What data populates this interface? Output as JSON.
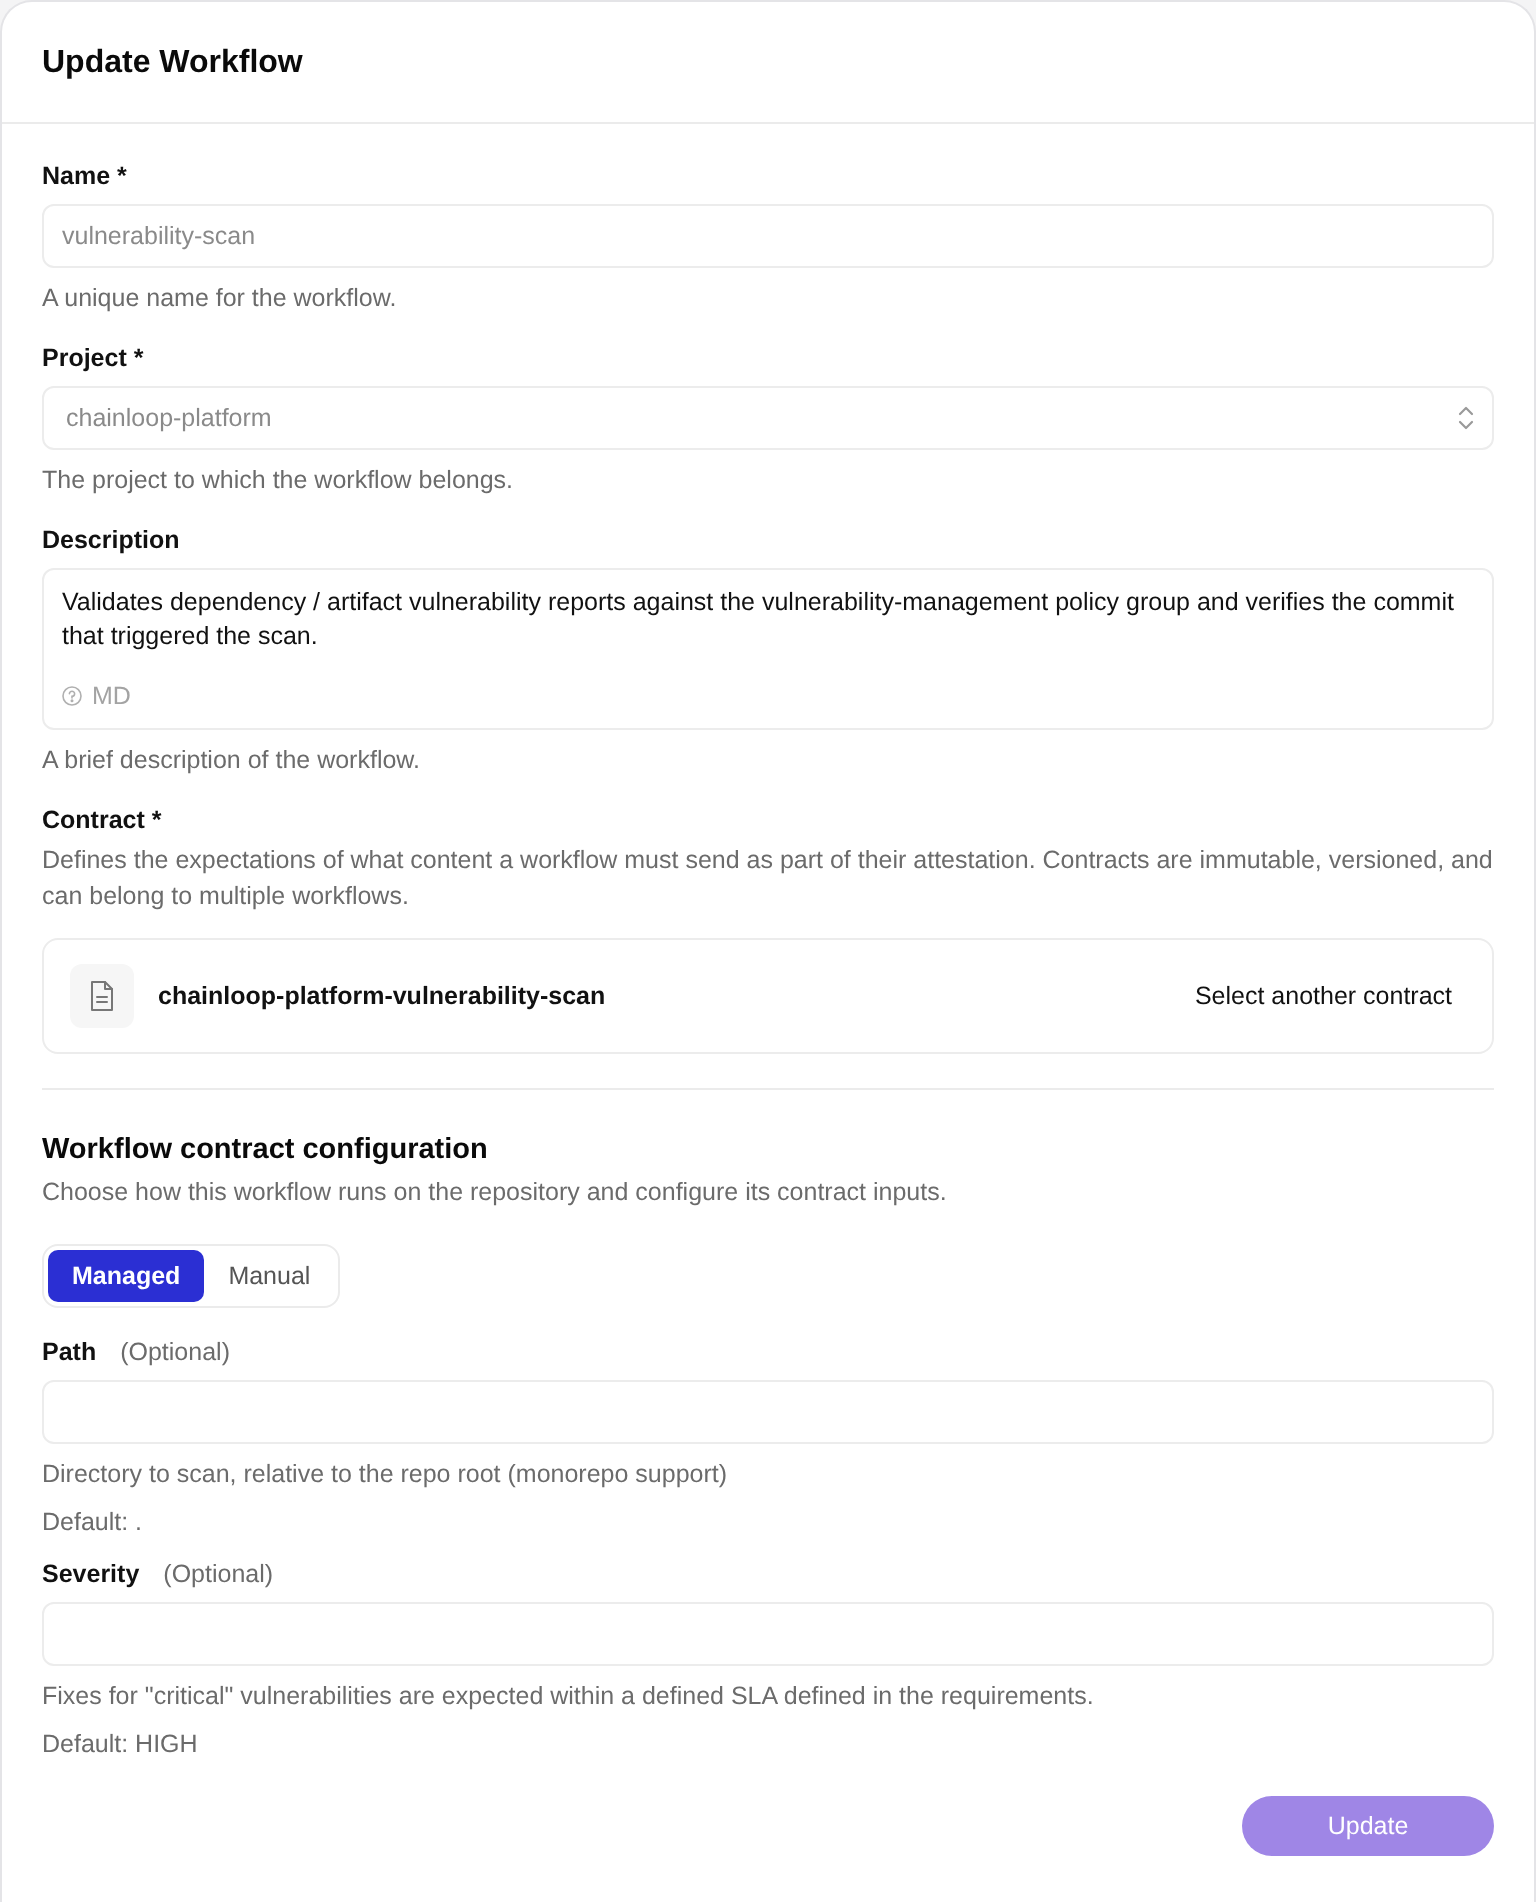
{
  "dialog": {
    "title": "Update Workflow"
  },
  "fields": [
    {
      "kind": "input",
      "label": "Name *",
      "value": "vulnerability-scan",
      "disabled": true,
      "help": "A unique name for the workflow."
    },
    {
      "kind": "select",
      "label": "Project *",
      "value": "chainloop-platform",
      "disabled": true,
      "help": "The project to which the workflow belongs."
    },
    {
      "kind": "textarea",
      "label": "Description",
      "value": "Validates dependency / artifact vulnerability reports against the vulnerability-management policy group and verifies the commit that triggered the scan.",
      "badge": "MD",
      "help": "A brief description of the workflow."
    },
    {
      "kind": "contract",
      "label": "Contract *",
      "description": "Defines the expectations of what content a workflow must send as part of their attestation. Contracts are immutable, versioned, and can belong to multiple workflows.",
      "contract_name": "chainloop-platform-vulnerability-scan",
      "action": "Select another contract"
    }
  ],
  "configuration": {
    "title": "Workflow contract configuration",
    "subtitle": "Choose how this workflow runs on the repository and configure its contract inputs.",
    "modes": [
      {
        "label": "Managed",
        "selected": true
      },
      {
        "label": "Manual",
        "selected": false
      }
    ],
    "inputs": [
      {
        "label": "Path",
        "optional": "(Optional)",
        "help": "Directory to scan, relative to the repo root (monorepo support)",
        "default": "Default: ."
      },
      {
        "label": "Severity",
        "optional": "(Optional)",
        "help": "Fixes for \"critical\" vulnerabilities are expected within a defined SLA defined in the requirements.",
        "default": "Default: HIGH"
      }
    ]
  },
  "submit": {
    "label": "Update",
    "disabled": true
  }
}
